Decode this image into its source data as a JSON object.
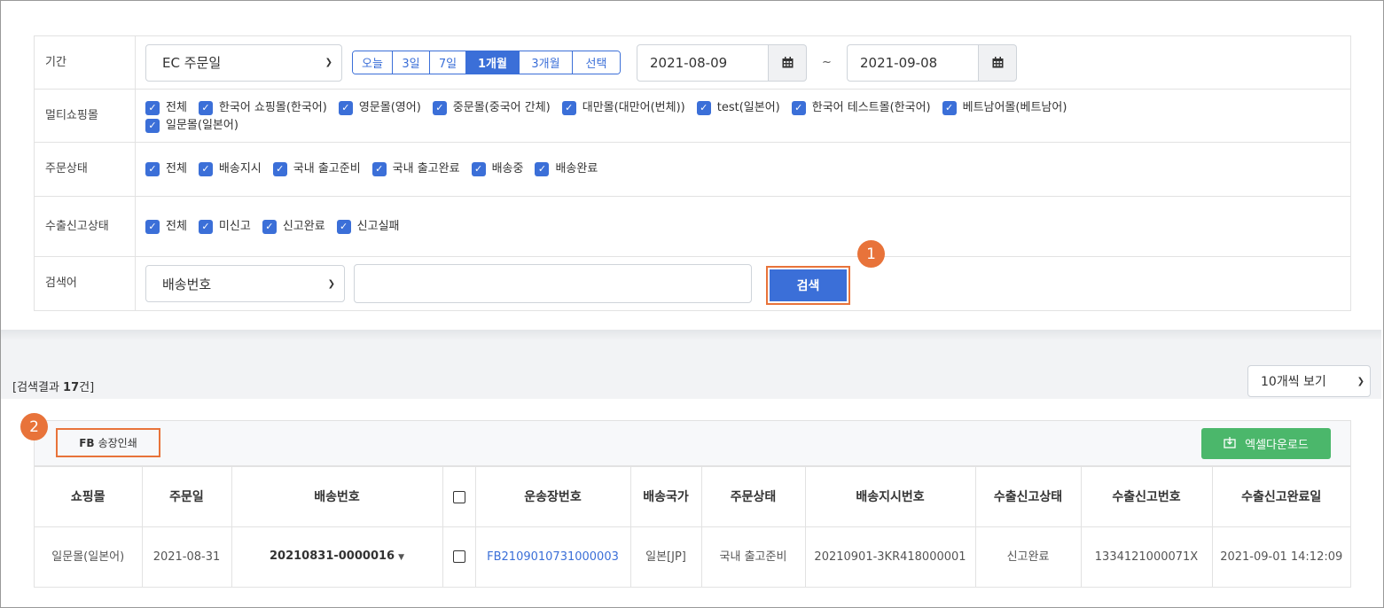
{
  "filters": {
    "period": {
      "label": "기간",
      "select_value": "EC 주문일",
      "quick_buttons": [
        "오늘",
        "3일",
        "7일",
        "1개월",
        "3개월",
        "선택"
      ],
      "active_index": 3,
      "start_date": "2021-08-09",
      "end_date": "2021-09-08",
      "range_separator": "~"
    },
    "multi_mall": {
      "label": "멀티쇼핑몰",
      "options": [
        "전체",
        "한국어 쇼핑몰(한국어)",
        "영문몰(영어)",
        "중문몰(중국어 간체)",
        "대만몰(대만어(번체))",
        "test(일본어)",
        "한국어 테스트몰(한국어)",
        "베트남어몰(베트남어)",
        "일문몰(일본어)"
      ]
    },
    "order_status": {
      "label": "주문상태",
      "options": [
        "전체",
        "배송지시",
        "국내 출고준비",
        "국내 출고완료",
        "배송중",
        "배송완료"
      ]
    },
    "export_status": {
      "label": "수출신고상태",
      "options": [
        "전체",
        "미신고",
        "신고완료",
        "신고실패"
      ]
    },
    "keyword": {
      "label": "검색어",
      "select_value": "배송번호",
      "input_value": "",
      "search_label": "검색"
    }
  },
  "markers": {
    "one": "1",
    "two": "2"
  },
  "results": {
    "prefix": "[검색결과 ",
    "count": "17",
    "suffix": "건]",
    "page_size": "10개씩 보기"
  },
  "toolbar": {
    "fb_bold": "FB",
    "fb_label": "송장인쇄",
    "excel_label": "엑셀다운로드",
    "excel_color": "#4bb76b"
  },
  "table": {
    "headers": [
      "쇼핑몰",
      "주문일",
      "배송번호",
      "",
      "운송장번호",
      "배송국가",
      "주문상태",
      "배송지시번호",
      "수출신고상태",
      "수출신고번호",
      "수출신고완료일"
    ],
    "rows": [
      {
        "mall": "일문몰(일본어)",
        "order_date": "2021-08-31",
        "shipping_no": "20210831-0000016",
        "tracking_no": "FB2109010731000003",
        "country": "일본[JP]",
        "status": "국내 출고준비",
        "instruction_no": "20210901-3KR418000001",
        "export_status": "신고완료",
        "export_no": "1334121000071X",
        "export_done": "2021-09-01 14:12:09"
      }
    ]
  },
  "colors": {
    "accent": "#3b6fd8",
    "highlight": "#e8733a"
  }
}
